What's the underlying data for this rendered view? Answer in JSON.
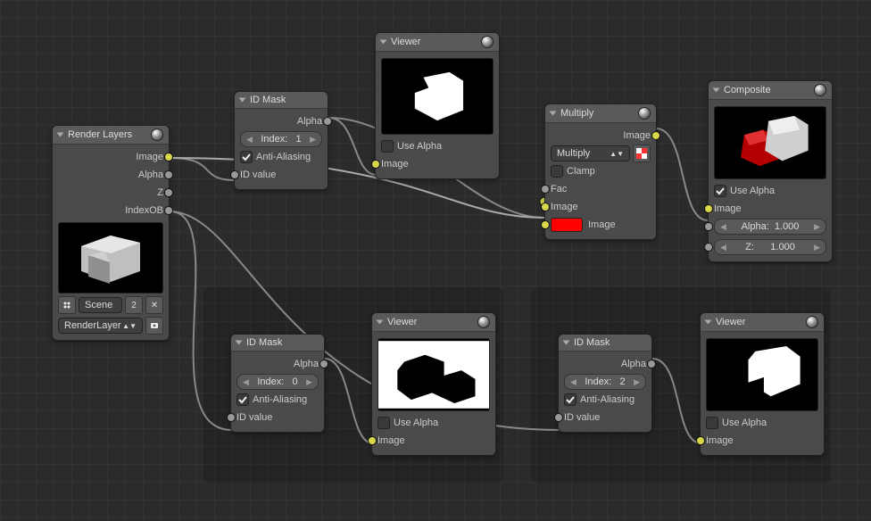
{
  "nodes": {
    "renderLayers": {
      "title": "Render Layers",
      "outputs": [
        "Image",
        "Alpha",
        "Z",
        "IndexOB"
      ],
      "scene_label": "Scene",
      "scene_count": "2",
      "layer_label": "RenderLayer"
    },
    "idmask1": {
      "title": "ID Mask",
      "out": "Alpha",
      "index_label": "Index:",
      "index_value": "1",
      "aa_label": "Anti-Aliasing",
      "in": "ID value"
    },
    "idmask0": {
      "title": "ID Mask",
      "out": "Alpha",
      "index_label": "Index:",
      "index_value": "0",
      "aa_label": "Anti-Aliasing",
      "in": "ID value"
    },
    "idmask2": {
      "title": "ID Mask",
      "out": "Alpha",
      "index_label": "Index:",
      "index_value": "2",
      "aa_label": "Anti-Aliasing",
      "in": "ID value"
    },
    "multiply": {
      "title": "Multiply",
      "out": "Image",
      "mode_label": "Multiply",
      "clamp_label": "Clamp",
      "fac_label": "Fac",
      "image1_label": "Image",
      "image2_label": "Image",
      "color_hex": "#ff0000"
    },
    "viewer1": {
      "title": "Viewer",
      "usealpha_label": "Use Alpha",
      "in": "Image"
    },
    "viewer0": {
      "title": "Viewer",
      "usealpha_label": "Use Alpha",
      "in": "Image"
    },
    "viewer2": {
      "title": "Viewer",
      "usealpha_label": "Use Alpha",
      "in": "Image"
    },
    "composite": {
      "title": "Composite",
      "usealpha_label": "Use Alpha",
      "in_image": "Image",
      "alpha_label": "Alpha:",
      "alpha_value": "1.000",
      "z_label": "Z:",
      "z_value": "1.000"
    }
  }
}
